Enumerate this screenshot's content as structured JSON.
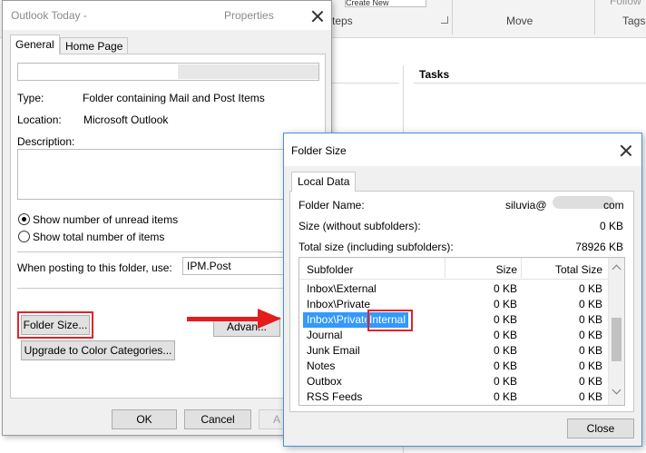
{
  "background": {
    "ribbon_labels": {
      "steps": "teps",
      "move": "Move",
      "tags": "Tags",
      "follow": "Follow"
    },
    "quick_step_input": "Create New",
    "tasks_heading": "Tasks"
  },
  "properties_dialog": {
    "title": "Outlook Today -",
    "title_suffix": "Properties",
    "tabs": [
      "General",
      "Home Page"
    ],
    "type_label": "Type:",
    "type_value": "Folder containing Mail and Post Items",
    "location_label": "Location:",
    "location_value": "Microsoft Outlook",
    "description_label": "Description:",
    "radio_unread": "Show number of unread items",
    "radio_total": "Show total number of items",
    "posting_label": "When posting to this folder, use:",
    "posting_value": "IPM.Post",
    "folder_size_button": "Folder Size...",
    "advanced_button": "Advan...",
    "upgrade_button": "Upgrade to Color Categories...",
    "ok_button": "OK",
    "cancel_button": "Cancel",
    "apply_button": "A"
  },
  "folder_size_dialog": {
    "title": "Folder Size",
    "tab": "Local Data",
    "folder_name_label": "Folder Name:",
    "folder_name_start": "siluvia@",
    "folder_name_end": "com",
    "size_label": "Size (without subfolders):",
    "size_value": "0 KB",
    "total_label": "Total size (including subfolders):",
    "total_value": "78926 KB",
    "columns": [
      "Subfolder",
      "Size",
      "Total Size"
    ],
    "rows": [
      {
        "name": "Inbox\\External",
        "size": "0 KB",
        "total": "0 KB"
      },
      {
        "name": "Inbox\\Private",
        "size": "0 KB",
        "total": "0 KB"
      },
      {
        "name_a": "Inbox\\Private",
        "name_b": "Internal",
        "size": "0 KB",
        "total": "0 KB"
      },
      {
        "name": "Journal",
        "size": "0 KB",
        "total": "0 KB"
      },
      {
        "name": "Junk Email",
        "size": "0 KB",
        "total": "0 KB"
      },
      {
        "name": "Notes",
        "size": "0 KB",
        "total": "0 KB"
      },
      {
        "name": "Outbox",
        "size": "0 KB",
        "total": "0 KB"
      },
      {
        "name": "RSS Feeds",
        "size": "0 KB",
        "total": "0 KB"
      }
    ],
    "close_button": "Close"
  },
  "colors": {
    "highlight": "#3399ff",
    "annotation_red": "#e0242b"
  }
}
